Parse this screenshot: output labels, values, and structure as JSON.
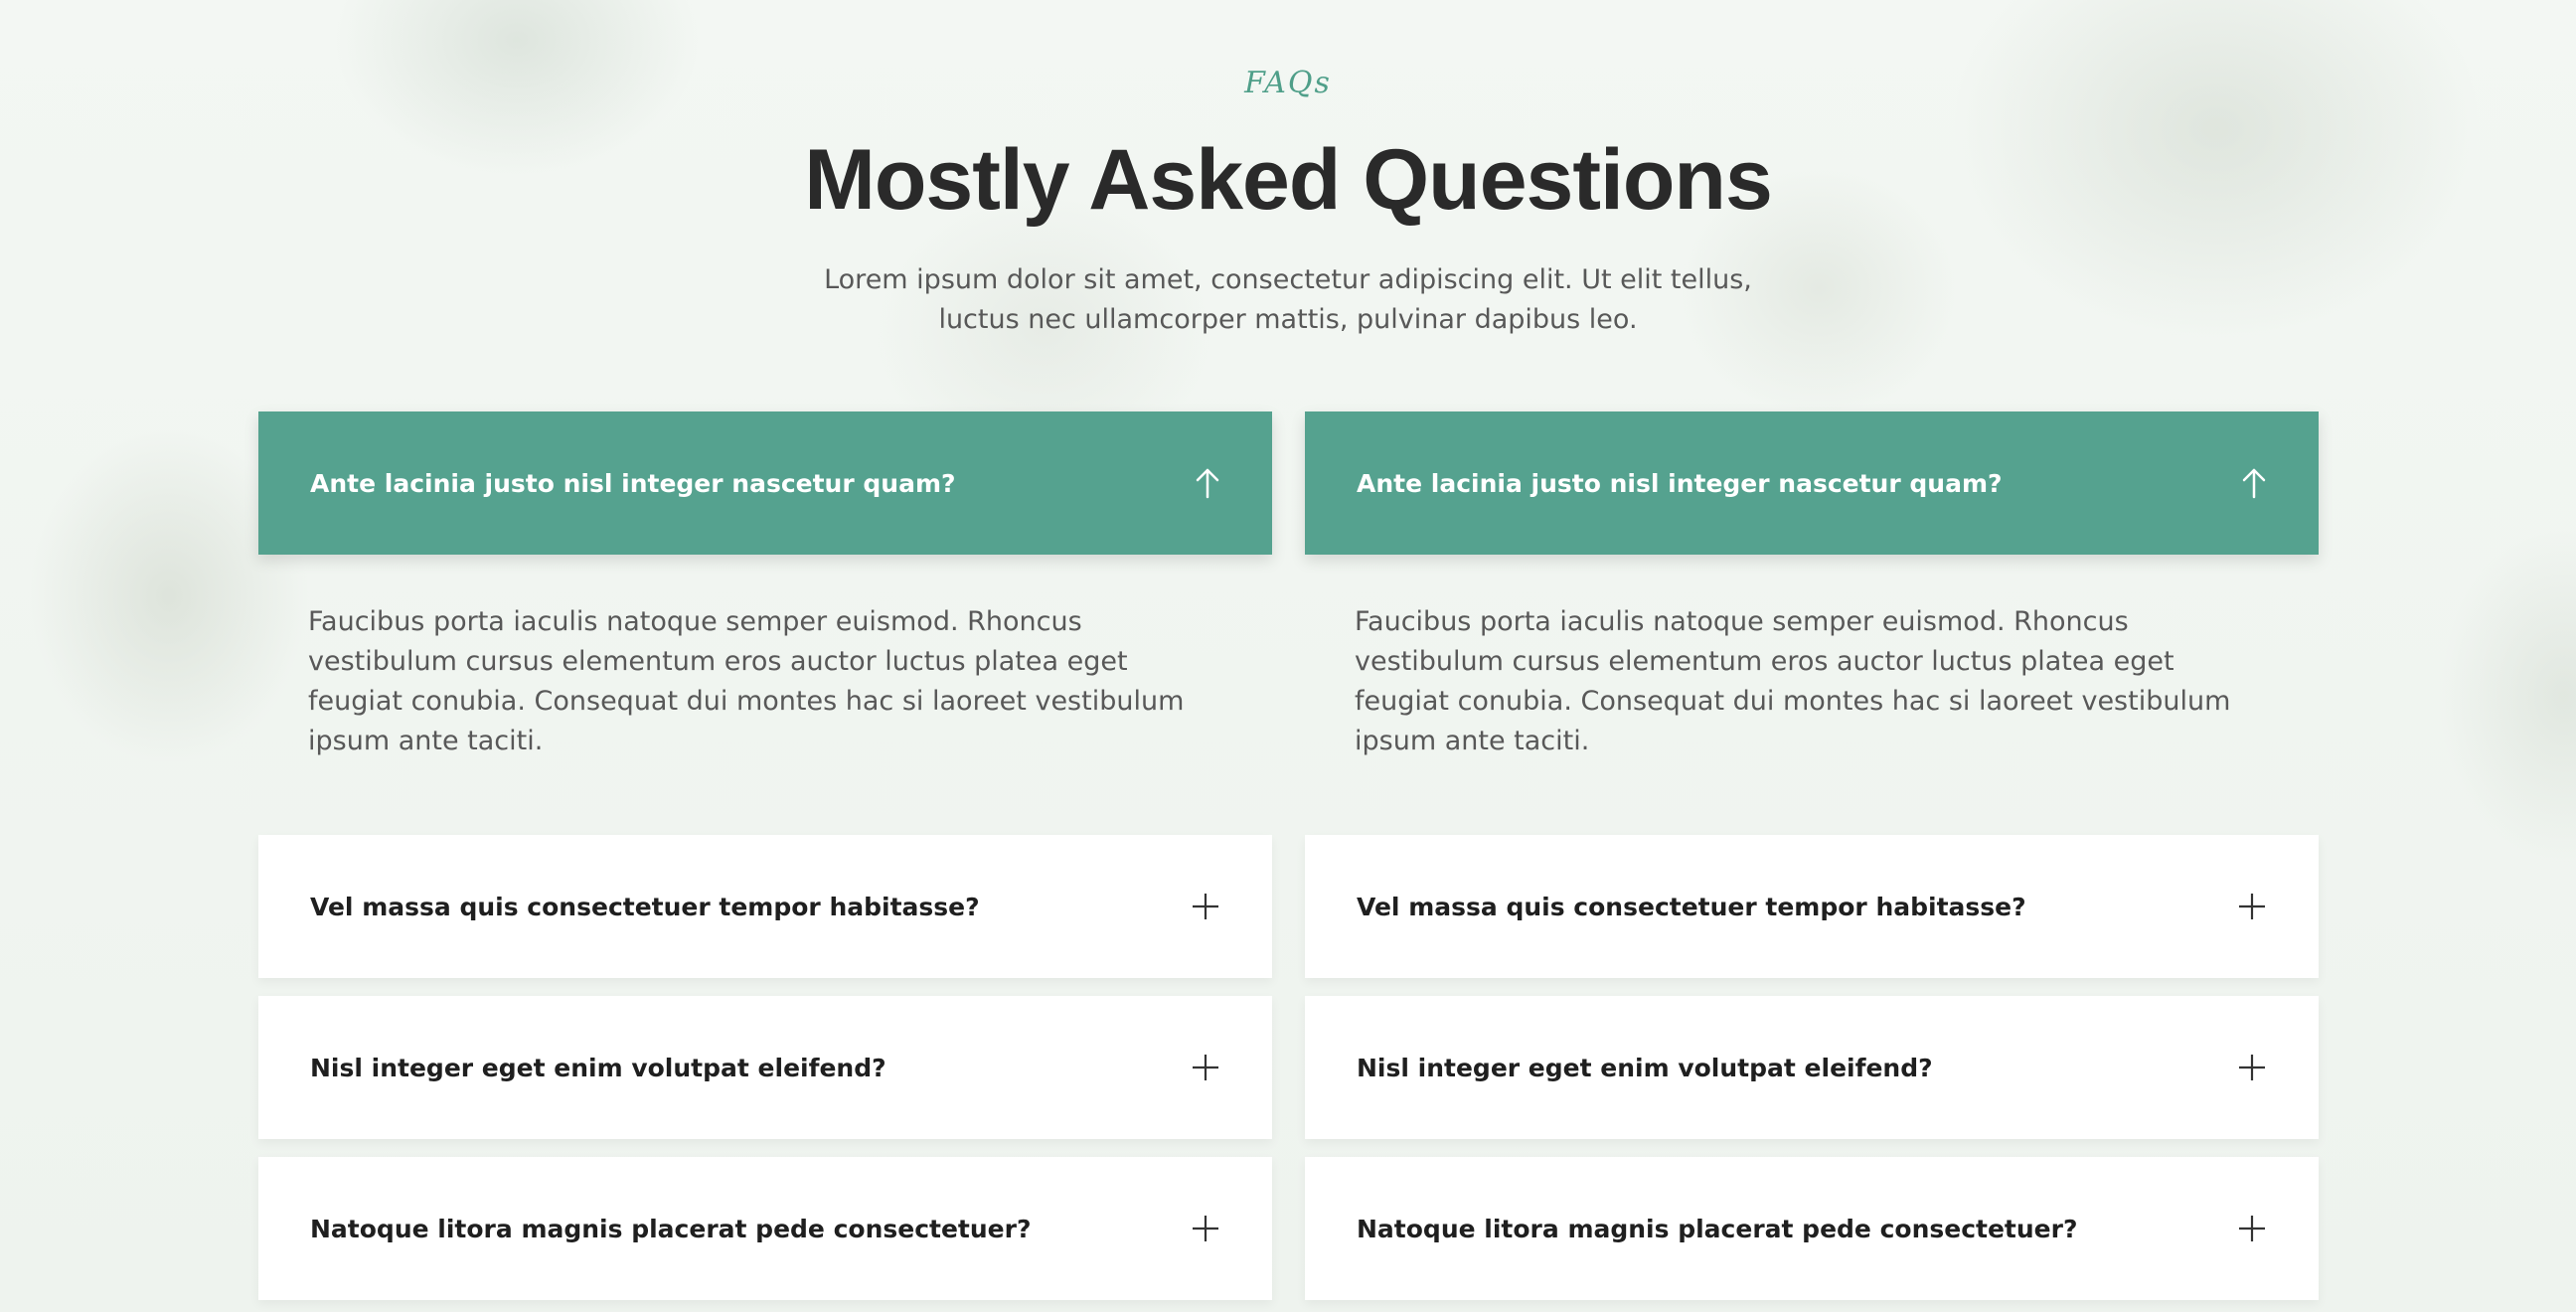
{
  "header": {
    "eyebrow": "FAQs",
    "title": "Mostly Asked Questions",
    "subtitle": "Lorem ipsum dolor sit amet, consectetur adipiscing elit. Ut elit tellus, luctus nec ullamcorper mattis, pulvinar dapibus leo."
  },
  "colors": {
    "accent": "#55a28f",
    "eyebrow": "#4f9f89",
    "title": "#2a2a2a",
    "body_text": "#585858",
    "card_bg": "#ffffff"
  },
  "faq_columns": [
    {
      "open_item": {
        "question": "Ante lacinia justo nisl integer nascetur quam?",
        "answer": "Faucibus porta iaculis natoque semper euismod. Rhoncus vestibulum cursus elementum eros auctor luctus platea eget feugiat conubia. Consequat dui montes hac si laoreet vestibulum ipsum ante taciti.",
        "icon": "arrow-up-icon"
      },
      "closed_items": [
        {
          "question": "Vel massa quis consectetuer tempor habitasse?",
          "icon": "plus-icon"
        },
        {
          "question": "Nisl integer eget enim volutpat eleifend?",
          "icon": "plus-icon"
        },
        {
          "question": "Natoque litora magnis placerat pede consectetuer?",
          "icon": "plus-icon"
        }
      ]
    },
    {
      "open_item": {
        "question": "Ante lacinia justo nisl integer nascetur quam?",
        "answer": "Faucibus porta iaculis natoque semper euismod. Rhoncus vestibulum cursus elementum eros auctor luctus platea eget feugiat conubia. Consequat dui montes hac si laoreet vestibulum ipsum ante taciti.",
        "icon": "arrow-up-icon"
      },
      "closed_items": [
        {
          "question": "Vel massa quis consectetuer tempor habitasse?",
          "icon": "plus-icon"
        },
        {
          "question": "Nisl integer eget enim volutpat eleifend?",
          "icon": "plus-icon"
        },
        {
          "question": "Natoque litora magnis placerat pede consectetuer?",
          "icon": "plus-icon"
        }
      ]
    }
  ]
}
